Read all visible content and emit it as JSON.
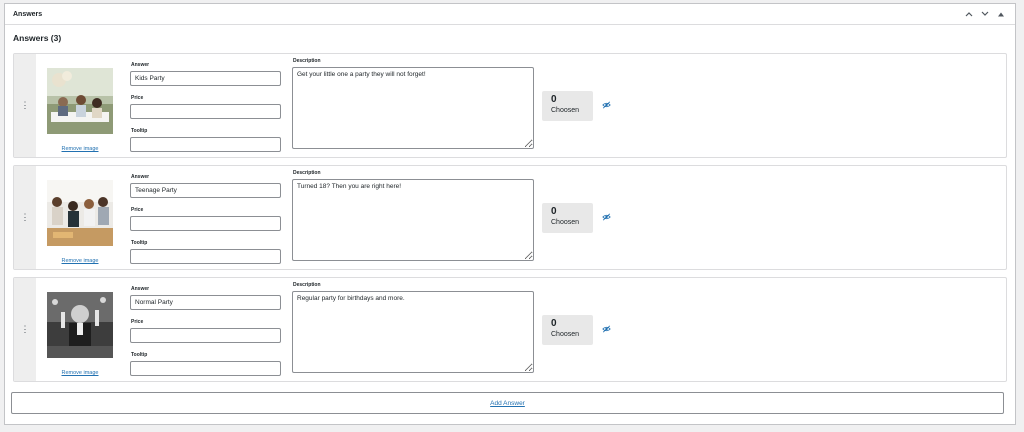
{
  "panel": {
    "title": "Answers"
  },
  "section": {
    "heading": "Answers (3)"
  },
  "labels": {
    "answer": "Answer",
    "price": "Price",
    "tooltip": "Tooltip",
    "description": "Description",
    "remove_image": "Remove image",
    "chosen": "Choosen"
  },
  "answers": [
    {
      "answer": "Kids Party",
      "price": "",
      "tooltip": "",
      "description": "Get your little one a party they will not forget!",
      "chosen_count": "0"
    },
    {
      "answer": "Teenage Party",
      "price": "",
      "tooltip": "",
      "description": "Turned 18? Then you are right here!",
      "chosen_count": "0"
    },
    {
      "answer": "Normal Party",
      "price": "",
      "tooltip": "",
      "description": "Regular party for birthdays and more.",
      "chosen_count": "0"
    }
  ],
  "add_answer_label": "Add Answer",
  "icons": {
    "move_up": "chevron-up-icon",
    "move_down": "chevron-down-icon",
    "toggle": "triangle-up-icon",
    "drag": "vertical-dots-icon",
    "visibility": "eye-slash-icon"
  },
  "colors": {
    "link": "#2271b1",
    "border": "#c3c4c7",
    "handle_bg": "#eeeeee",
    "chosen_bg": "#e8e8e8"
  }
}
